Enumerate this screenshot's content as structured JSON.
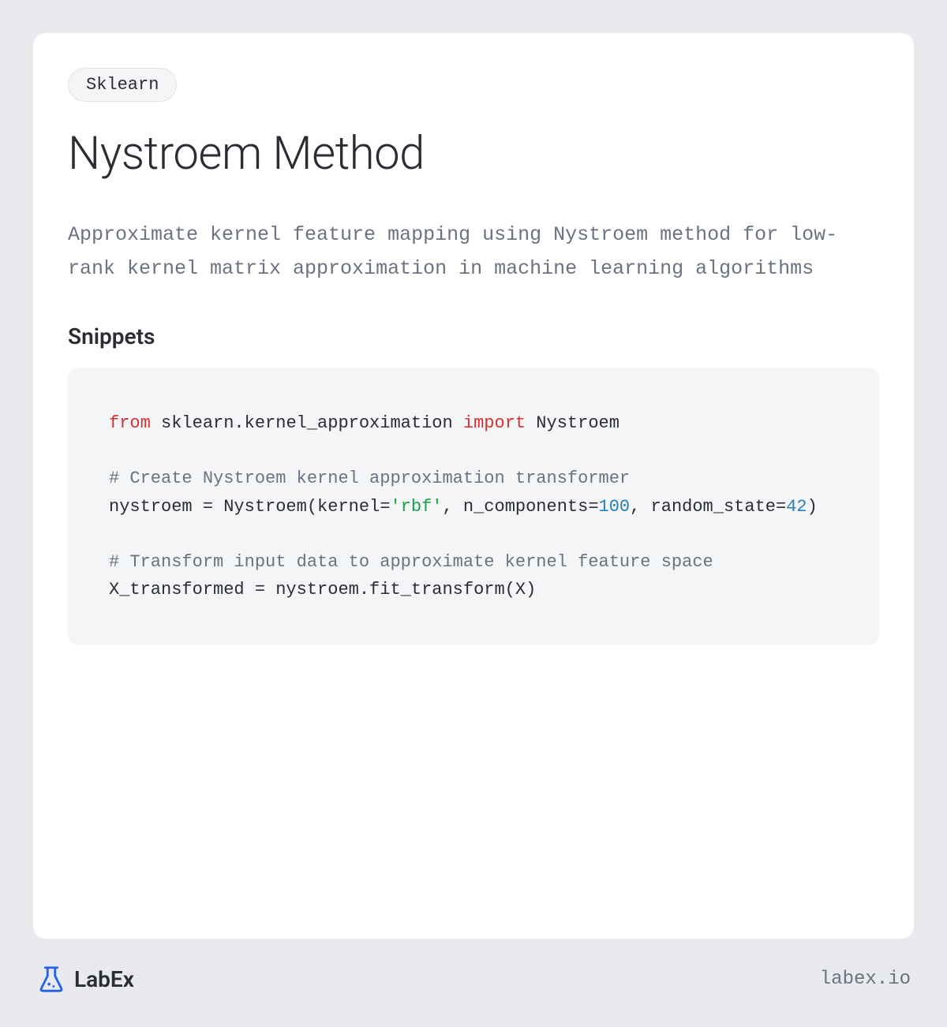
{
  "tag": "Sklearn",
  "title": "Nystroem Method",
  "description": "Approximate kernel feature mapping using Nystroem method for low-rank kernel matrix approximation in machine learning algorithms",
  "snippets_heading": "Snippets",
  "code": {
    "line1_from": "from",
    "line1_module": " sklearn.kernel_approximation ",
    "line1_import": "import",
    "line1_name": " Nystroem",
    "comment1": "# Create Nystroem kernel approximation transformer",
    "line2_pre": "nystroem = Nystroem(kernel=",
    "line2_str": "'rbf'",
    "line2_mid1": ", n_components=",
    "line2_num1": "100",
    "line2_mid2": ", random_state=",
    "line2_num2": "42",
    "line2_end": ")",
    "comment2": "# Transform input data to approximate kernel feature space",
    "line3": "X_transformed = nystroem.fit_transform(X)"
  },
  "footer": {
    "logo_text": "LabEx",
    "url": "labex.io"
  }
}
